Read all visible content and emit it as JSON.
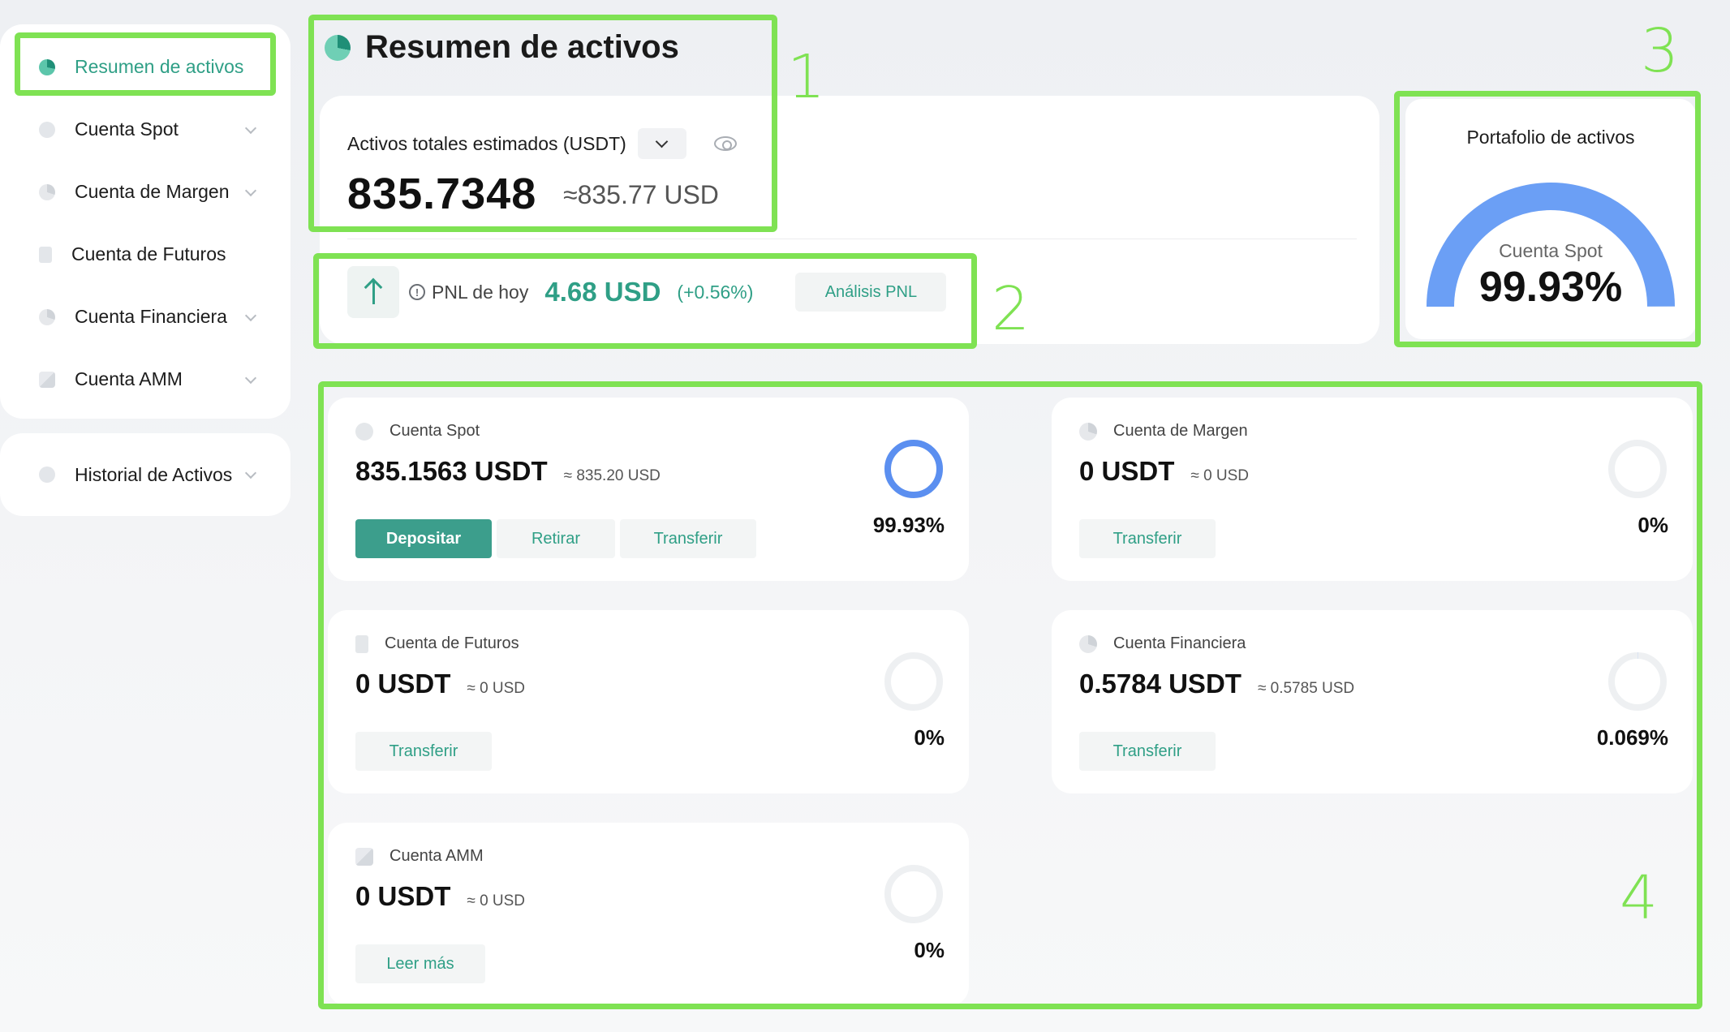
{
  "sidebar": {
    "items": [
      {
        "label": "Resumen de activos"
      },
      {
        "label": "Cuenta Spot"
      },
      {
        "label": "Cuenta de Margen"
      },
      {
        "label": "Cuenta de Futuros"
      },
      {
        "label": "Cuenta Financiera"
      },
      {
        "label": "Cuenta AMM"
      }
    ],
    "history": {
      "label": "Historial de Activos"
    }
  },
  "header": {
    "title": "Resumen de activos"
  },
  "summary": {
    "estimated_label": "Activos totales estimados (USDT)",
    "total": "835.7348",
    "approx_usd": "≈835.77 USD",
    "pnl_label": "PNL de hoy",
    "pnl_value": "4.68 USD",
    "pnl_pct": "(+0.56%)",
    "pnl_button": "Análisis PNL"
  },
  "portfolio": {
    "title": "Portafolio de activos",
    "label": "Cuenta Spot",
    "value": "99.93%",
    "fraction": 0.9993
  },
  "accounts": {
    "spot": {
      "name": "Cuenta Spot",
      "usdt": "835.1563 USDT",
      "usd": "≈ 835.20 USD",
      "pct": "99.93%",
      "fraction": 0.9993,
      "deposit": "Depositar",
      "withdraw": "Retirar",
      "transfer": "Transferir"
    },
    "margin": {
      "name": "Cuenta de Margen",
      "usdt": "0 USDT",
      "usd": "≈ 0 USD",
      "pct": "0%",
      "fraction": 0,
      "transfer": "Transferir"
    },
    "futures": {
      "name": "Cuenta de Futuros",
      "usdt": "0 USDT",
      "usd": "≈ 0 USD",
      "pct": "0%",
      "fraction": 0,
      "transfer": "Transferir"
    },
    "financial": {
      "name": "Cuenta Financiera",
      "usdt": "0.5784 USDT",
      "usd": "≈ 0.5785 USD",
      "pct": "0.069%",
      "fraction": 0.00069,
      "transfer": "Transferir"
    },
    "amm": {
      "name": "Cuenta AMM",
      "usdt": "0 USDT",
      "usd": "≈ 0 USD",
      "pct": "0%",
      "fraction": 0,
      "more": "Leer más"
    }
  },
  "annotations": {
    "n1": "1",
    "n2": "2",
    "n3": "3",
    "n4": "4"
  },
  "colors": {
    "accent": "#2f9f86",
    "highlight": "#7fe253",
    "gauge": "#6b9ff5"
  }
}
